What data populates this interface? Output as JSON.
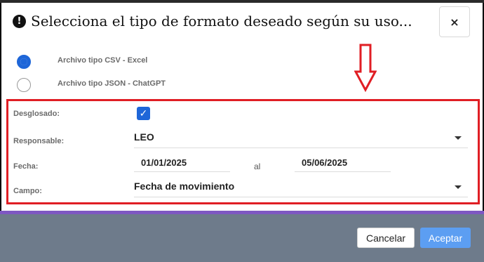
{
  "header": {
    "title": "Selecciona el tipo de formato deseado según su uso...",
    "exclaim": "!",
    "close": "×"
  },
  "formats": [
    {
      "label": "Archivo tipo CSV - Excel",
      "checked": true
    },
    {
      "label": "Archivo tipo JSON - ChatGPT",
      "checked": false
    }
  ],
  "fields": {
    "desglosado_label": "Desglosado:",
    "desglosado_checked": true,
    "checkmark": "✓",
    "responsable_label": "Responsable:",
    "responsable_value": "LEO",
    "fecha_label": "Fecha:",
    "fecha_desde": "01/01/2025",
    "fecha_sep": "al",
    "fecha_hasta": "05/06/2025",
    "campo_label": "Campo:",
    "campo_value": "Fecha de movimiento"
  },
  "footer": {
    "cancel_label": "Cancelar",
    "accept_label": "Aceptar"
  },
  "colors": {
    "accent_blue": "#1e66d8",
    "highlight_red": "#e01e24",
    "footer_bg": "#6e7b8b",
    "footer_stripe": "#7e57c2",
    "accept_bg": "#5c9ef2"
  }
}
